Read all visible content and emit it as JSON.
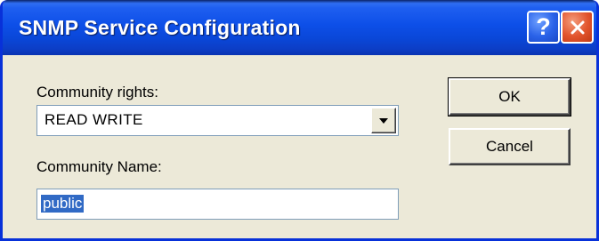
{
  "window": {
    "title": "SNMP Service Configuration",
    "help_glyph": "?",
    "close_glyph": "✕"
  },
  "form": {
    "rights_label": "Community rights:",
    "rights_value": "READ WRITE",
    "name_label": "Community Name:",
    "name_value": "public"
  },
  "buttons": {
    "ok_label": "OK",
    "cancel_label": "Cancel"
  },
  "colors": {
    "titlebar": "#0d4fe8",
    "dialog_background": "#ece9d8",
    "selection": "#316ac5",
    "close_button": "#e2542c"
  }
}
